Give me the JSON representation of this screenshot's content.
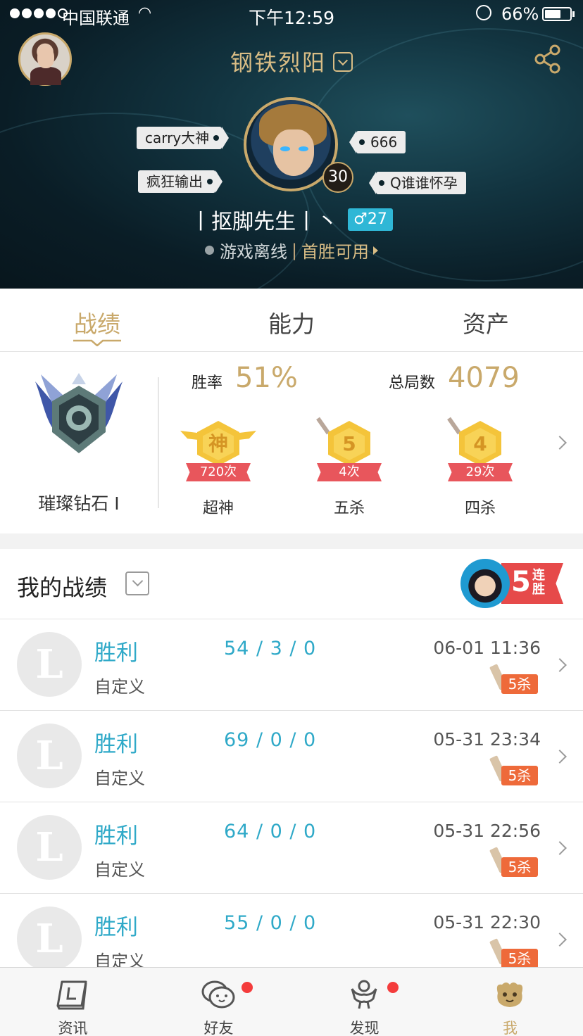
{
  "status_bar": {
    "carrier": "中国联通",
    "time": "下午12:59",
    "battery": "66%",
    "battery_level": 0.66
  },
  "header": {
    "server": "钢铁烈阳",
    "champion_level": "30",
    "tags": {
      "top_left": "carry大神",
      "bottom_left": "疯狂输出",
      "top_right": "666",
      "bottom_right": "Q谁谁怀孕"
    },
    "nickname": "丨抠脚先生丨丶",
    "gender_age": "♂27",
    "online_status": "游戏离线",
    "separator": "|",
    "first_win": "首胜可用"
  },
  "tabs": [
    "战绩",
    "能力",
    "资产"
  ],
  "stats": {
    "rank": "璀璨钻石 I",
    "win_rate_label": "胜率",
    "win_rate": "51%",
    "total_games_label": "总局数",
    "total_games": "4079",
    "medals": [
      {
        "glyph": "神",
        "count": "720次",
        "label": "超神"
      },
      {
        "glyph": "5",
        "count": "4次",
        "label": "五杀"
      },
      {
        "glyph": "4",
        "count": "29次",
        "label": "四杀"
      }
    ]
  },
  "records": {
    "title": "我的战绩",
    "streak_number": "5",
    "streak_text": "连胜",
    "items": [
      {
        "avatar": "L",
        "result": "胜利",
        "mode": "自定义",
        "kda": "54 / 3 / 0",
        "time": "06-01 11:36",
        "badge": "5杀"
      },
      {
        "avatar": "L",
        "result": "胜利",
        "mode": "自定义",
        "kda": "69 / 0 / 0",
        "time": "05-31 23:34",
        "badge": "5杀"
      },
      {
        "avatar": "L",
        "result": "胜利",
        "mode": "自定义",
        "kda": "64 / 0 / 0",
        "time": "05-31 22:56",
        "badge": "5杀"
      },
      {
        "avatar": "L",
        "result": "胜利",
        "mode": "自定义",
        "kda": "55 / 0 / 0",
        "time": "05-31 22:30",
        "badge": "5杀"
      }
    ]
  },
  "tabbar": {
    "items": [
      {
        "label": "资讯",
        "icon": "news-book-icon"
      },
      {
        "label": "好友",
        "icon": "friends-chat-icon"
      },
      {
        "label": "发现",
        "icon": "discover-icon"
      },
      {
        "label": "我",
        "icon": "me-poro-icon"
      }
    ]
  },
  "colors": {
    "gold": "#c9a96b",
    "teal": "#2fa9c8",
    "medal": "#f4c43a",
    "badge": "#ee6a3a",
    "notification": "#f43c3c"
  }
}
